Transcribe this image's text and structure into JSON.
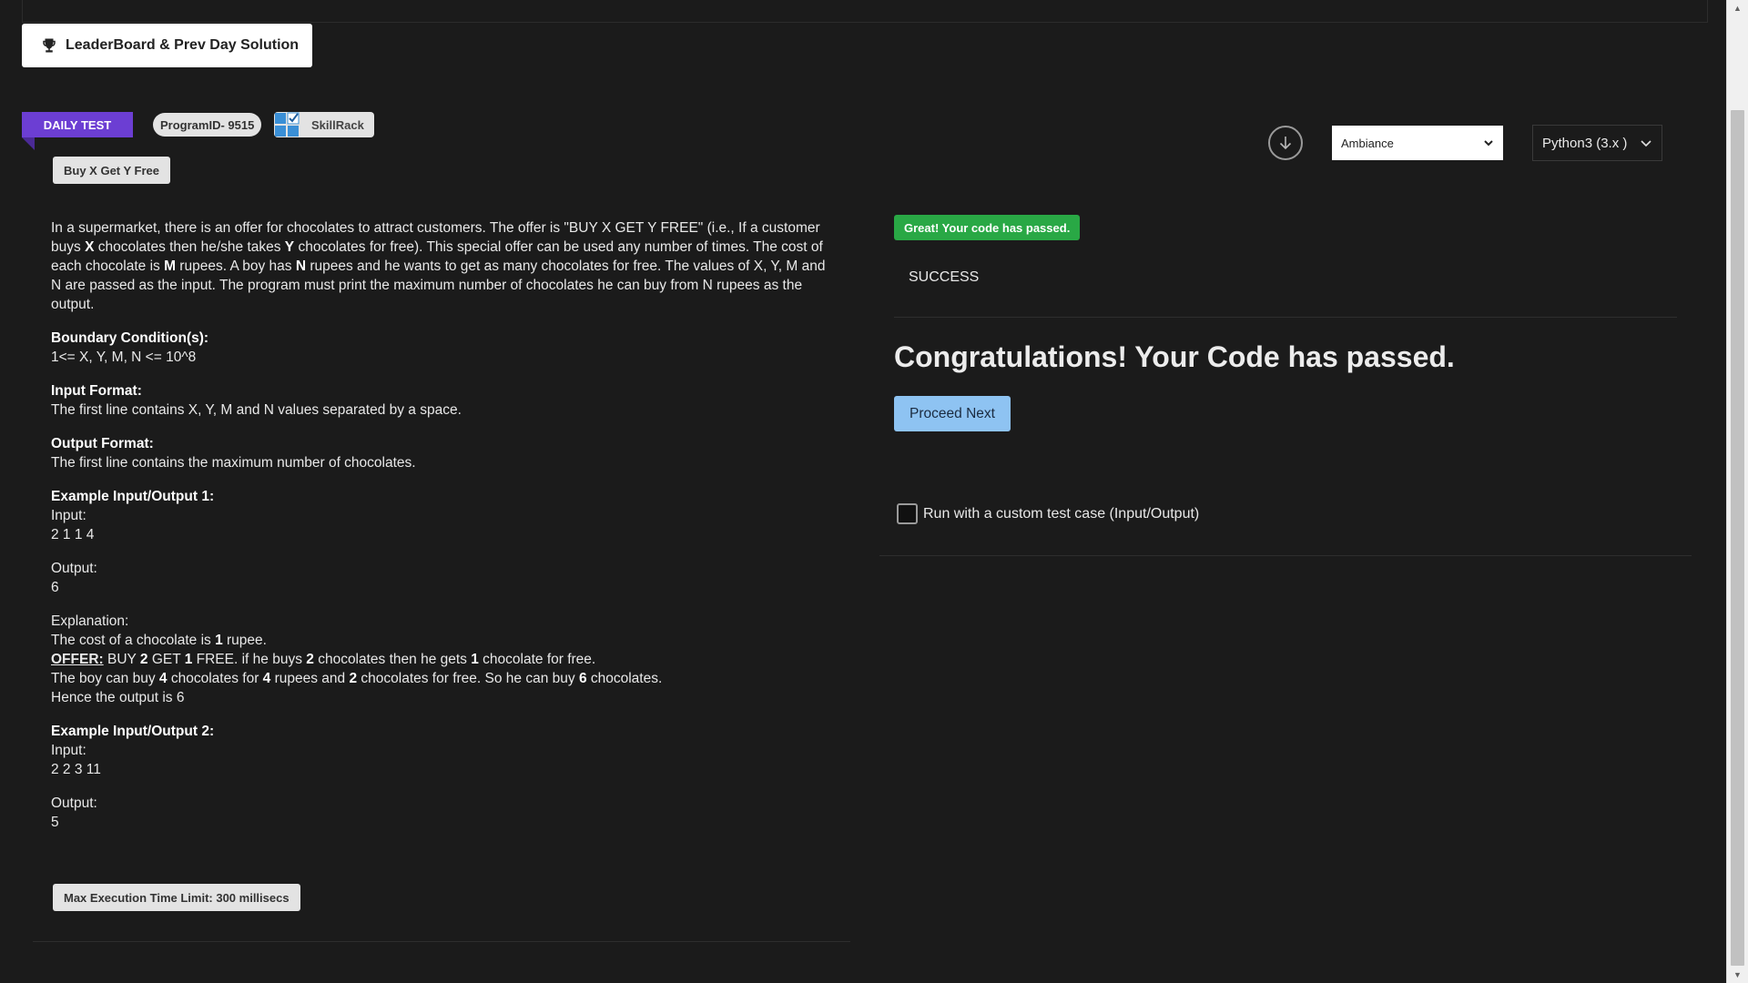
{
  "leaderboard_button": {
    "label": "LeaderBoard & Prev Day Solution",
    "icon": "trophy-icon"
  },
  "tags": {
    "daily_test": "DAILY TEST",
    "program_id": "ProgramID- 9515",
    "skillrack": "SkillRack",
    "problem_title": "Buy X Get Y Free",
    "exec_limit": "Max Execution Time Limit: 300 millisecs"
  },
  "problem": {
    "description_parts": {
      "p1": "In a supermarket, there is an offer for chocolates to attract customers. The offer is \"BUY X GET Y FREE\" (i.e., If a customer buys ",
      "x": "X",
      "p2": " chocolates then he/she takes ",
      "y": "Y",
      "p3": " chocolates for free). This special offer can be used any number of times. The cost of each chocolate is ",
      "m": "M",
      "p4": " rupees. A boy has ",
      "n": "N",
      "p5": " rupees and he wants to get as many chocolates for free. The values of X, Y, M and N are passed as the input. The program must print the maximum number of chocolates he can buy from N rupees as the output."
    },
    "boundary_heading": "Boundary Condition(s):",
    "boundary_text": "1<= X, Y, M, N <= 10^8",
    "input_heading": "Input Format:",
    "input_text": "The first line contains X, Y, M and N values separated by a space.",
    "output_heading": "Output Format:",
    "output_text": "The first line contains the maximum number of chocolates.",
    "example1_heading": "Example Input/Output 1:",
    "input_label": "Input:",
    "example1_input": "2 1 1 4",
    "output_label": "Output:",
    "example1_output": "6",
    "explanation_label": "Explanation:",
    "exp_line1_a": "The cost of a chocolate is ",
    "exp_line1_b": "1",
    "exp_line1_c": " rupee.",
    "exp_offer": "OFFER:",
    "exp_line2_a": " BUY ",
    "exp_line2_b": "2",
    "exp_line2_c": " GET ",
    "exp_line2_d": "1",
    "exp_line2_e": " FREE. if he buys ",
    "exp_line2_f": "2",
    "exp_line2_g": " chocolates then he gets ",
    "exp_line2_h": "1",
    "exp_line2_i": " chocolate for free.",
    "exp_line3_a": "The boy can buy ",
    "exp_line3_b": "4",
    "exp_line3_c": " chocolates for ",
    "exp_line3_d": "4",
    "exp_line3_e": " rupees and ",
    "exp_line3_f": "2",
    "exp_line3_g": " chocolates for free. So he can buy ",
    "exp_line3_h": "6",
    "exp_line3_i": " chocolates.",
    "exp_line4": "Hence the output is 6",
    "example2_heading": "Example Input/Output 2:",
    "example2_input": "2 2 3 11",
    "example2_output": "5"
  },
  "editor_controls": {
    "download_icon": "arrow-down-circle-icon",
    "theme": "Ambiance",
    "language": "Python3 (3.x )"
  },
  "result": {
    "badge": "Great! Your code has passed.",
    "status": "SUCCESS",
    "congrats": "Congratulations! Your Code has passed.",
    "proceed_button": "Proceed Next",
    "custom_test_label": "Run with a custom test case (Input/Output)"
  },
  "colors": {
    "background": "#1b1b1b",
    "ribbon": "#6c3ed3",
    "success_badge": "#29a845",
    "proceed_button": "#8ec3f2"
  }
}
